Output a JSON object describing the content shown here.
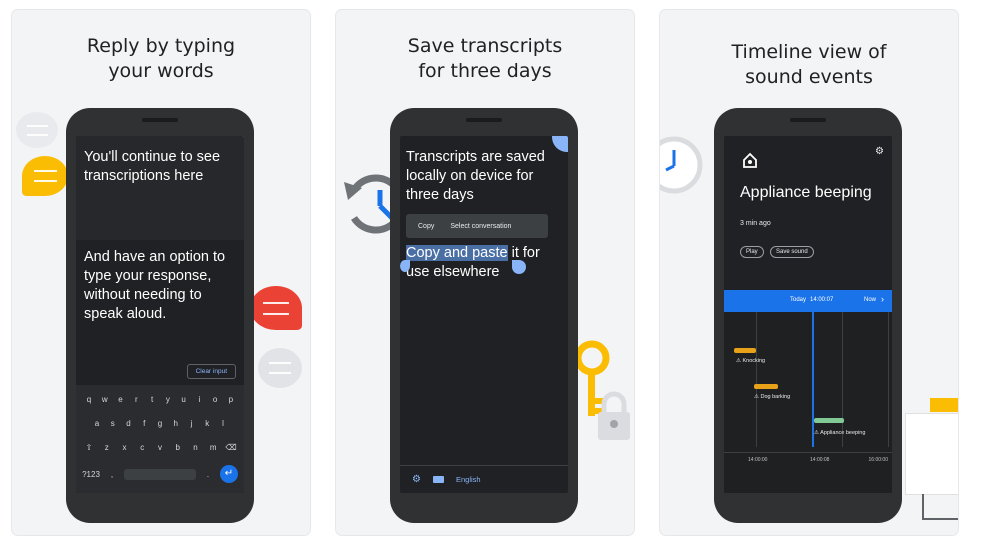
{
  "cards": [
    {
      "title_line1": "Reply by typing",
      "title_line2": "your words",
      "transcript": "You'll continue to see transcriptions here",
      "typed_text": "And have an option to type your response, without needing to speak aloud.",
      "clear_button": "Clear input",
      "keyboard_row1": [
        "q",
        "w",
        "e",
        "r",
        "t",
        "y",
        "u",
        "i",
        "o",
        "p"
      ],
      "keyboard_row2": [
        "a",
        "s",
        "d",
        "f",
        "g",
        "h",
        "j",
        "k",
        "l"
      ],
      "keyboard_row3": [
        "z",
        "x",
        "c",
        "v",
        "b",
        "n",
        "m"
      ],
      "symbols_key": "?123",
      "comma_key": ",",
      "period_key": ".",
      "colors": {
        "chat_yellow": "#fbbc04",
        "chat_red": "#ea4335",
        "chat_grey": "#dadce0",
        "accent": "#8ab4f8"
      }
    },
    {
      "title_line1": "Save transcripts",
      "title_line2": "for three days",
      "transcript": "Transcripts are saved locally on device for three days",
      "menu_copy": "Copy",
      "menu_select": "Select conversation",
      "selected_text": "Copy and paste",
      "rest_text": " it for use elsewhere",
      "language": "English",
      "icons": [
        "history-icon",
        "key-icon",
        "lock-icon",
        "gear-icon",
        "keyboard-icon"
      ]
    },
    {
      "title_line1": "Timeline view of",
      "title_line2": "sound events",
      "event_title": "Appliance beeping",
      "event_time": "3 min ago",
      "play_button": "Play",
      "save_button": "Save sound",
      "timeline_today": "Today",
      "timeline_date": "14:00:07",
      "timeline_now": "Now",
      "events": [
        "Knocking",
        "Dog barking",
        "Appliance beeping"
      ],
      "axis_labels": [
        "14:00:00",
        "14:00:08",
        "16:00:00"
      ],
      "colors": {
        "timeline_blue": "#1a73e8",
        "event_gold": "#e8a21a",
        "event_green": "#81c995"
      }
    }
  ]
}
